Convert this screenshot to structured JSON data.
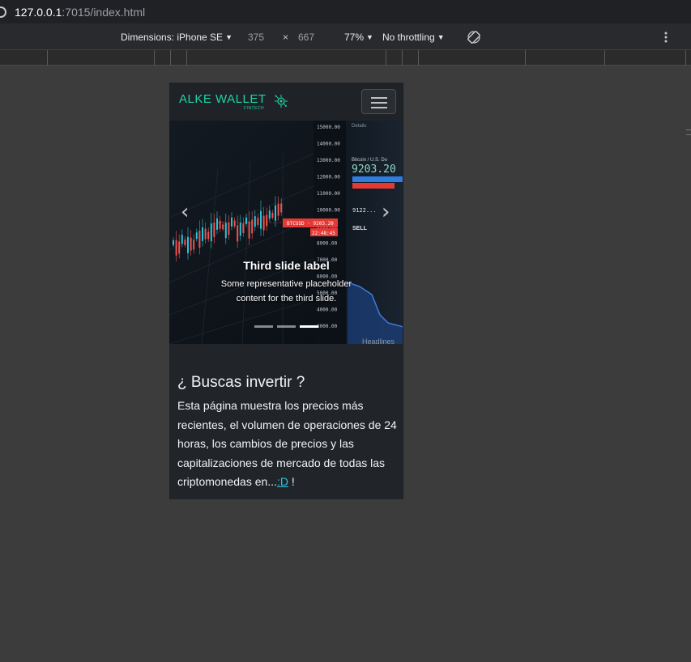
{
  "browser": {
    "url_host": "127.0.0.1",
    "url_rest": ":7015/index.html"
  },
  "device_toolbar": {
    "device_label": "Dimensions: iPhone SE",
    "width": "375",
    "times": "×",
    "height": "667",
    "zoom": "77%",
    "throttling": "No throttling"
  },
  "site": {
    "brand_name": "ALKE WALLET",
    "brand_sub": "FINTECH",
    "carousel": {
      "prev_label": "‹",
      "next_label": "›",
      "caption_title": "Third slide label",
      "caption_text": "Some representative placeholder content for the third slide.",
      "slides": 3,
      "active_slide": 3
    },
    "section": {
      "heading": "¿ Buscas invertir ?",
      "body": "Esta página muestra los precios más recientes, el volumen de operaciones de 24 horas, los cambios de precios y las capitalizaciones de mercado de todas las criptomonedas en...",
      "link_text": ":D",
      "trailing": " !"
    },
    "image_text": {
      "price_big": "9203.20",
      "pair": "Bitcoin / U.S. Do",
      "details": "Details",
      "btc_tag": "BTCUSD · 9203.20",
      "time_tag": "22:48:45",
      "sell": "SELL",
      "mini_price": "9122...",
      "ticks": [
        "15000.00",
        "14000.00",
        "13000.00",
        "12000.00",
        "11000.00",
        "10000.00",
        "9000.00",
        "8000.00",
        "7000.00",
        "6000.00",
        "5000.00",
        "4000.00",
        "3000.00"
      ],
      "headlines": "Headlines"
    }
  },
  "colors": {
    "brand": "#1fd3a2",
    "link": "#27c6e8",
    "candle_up": "#26c6da",
    "candle_down": "#ef5350"
  }
}
